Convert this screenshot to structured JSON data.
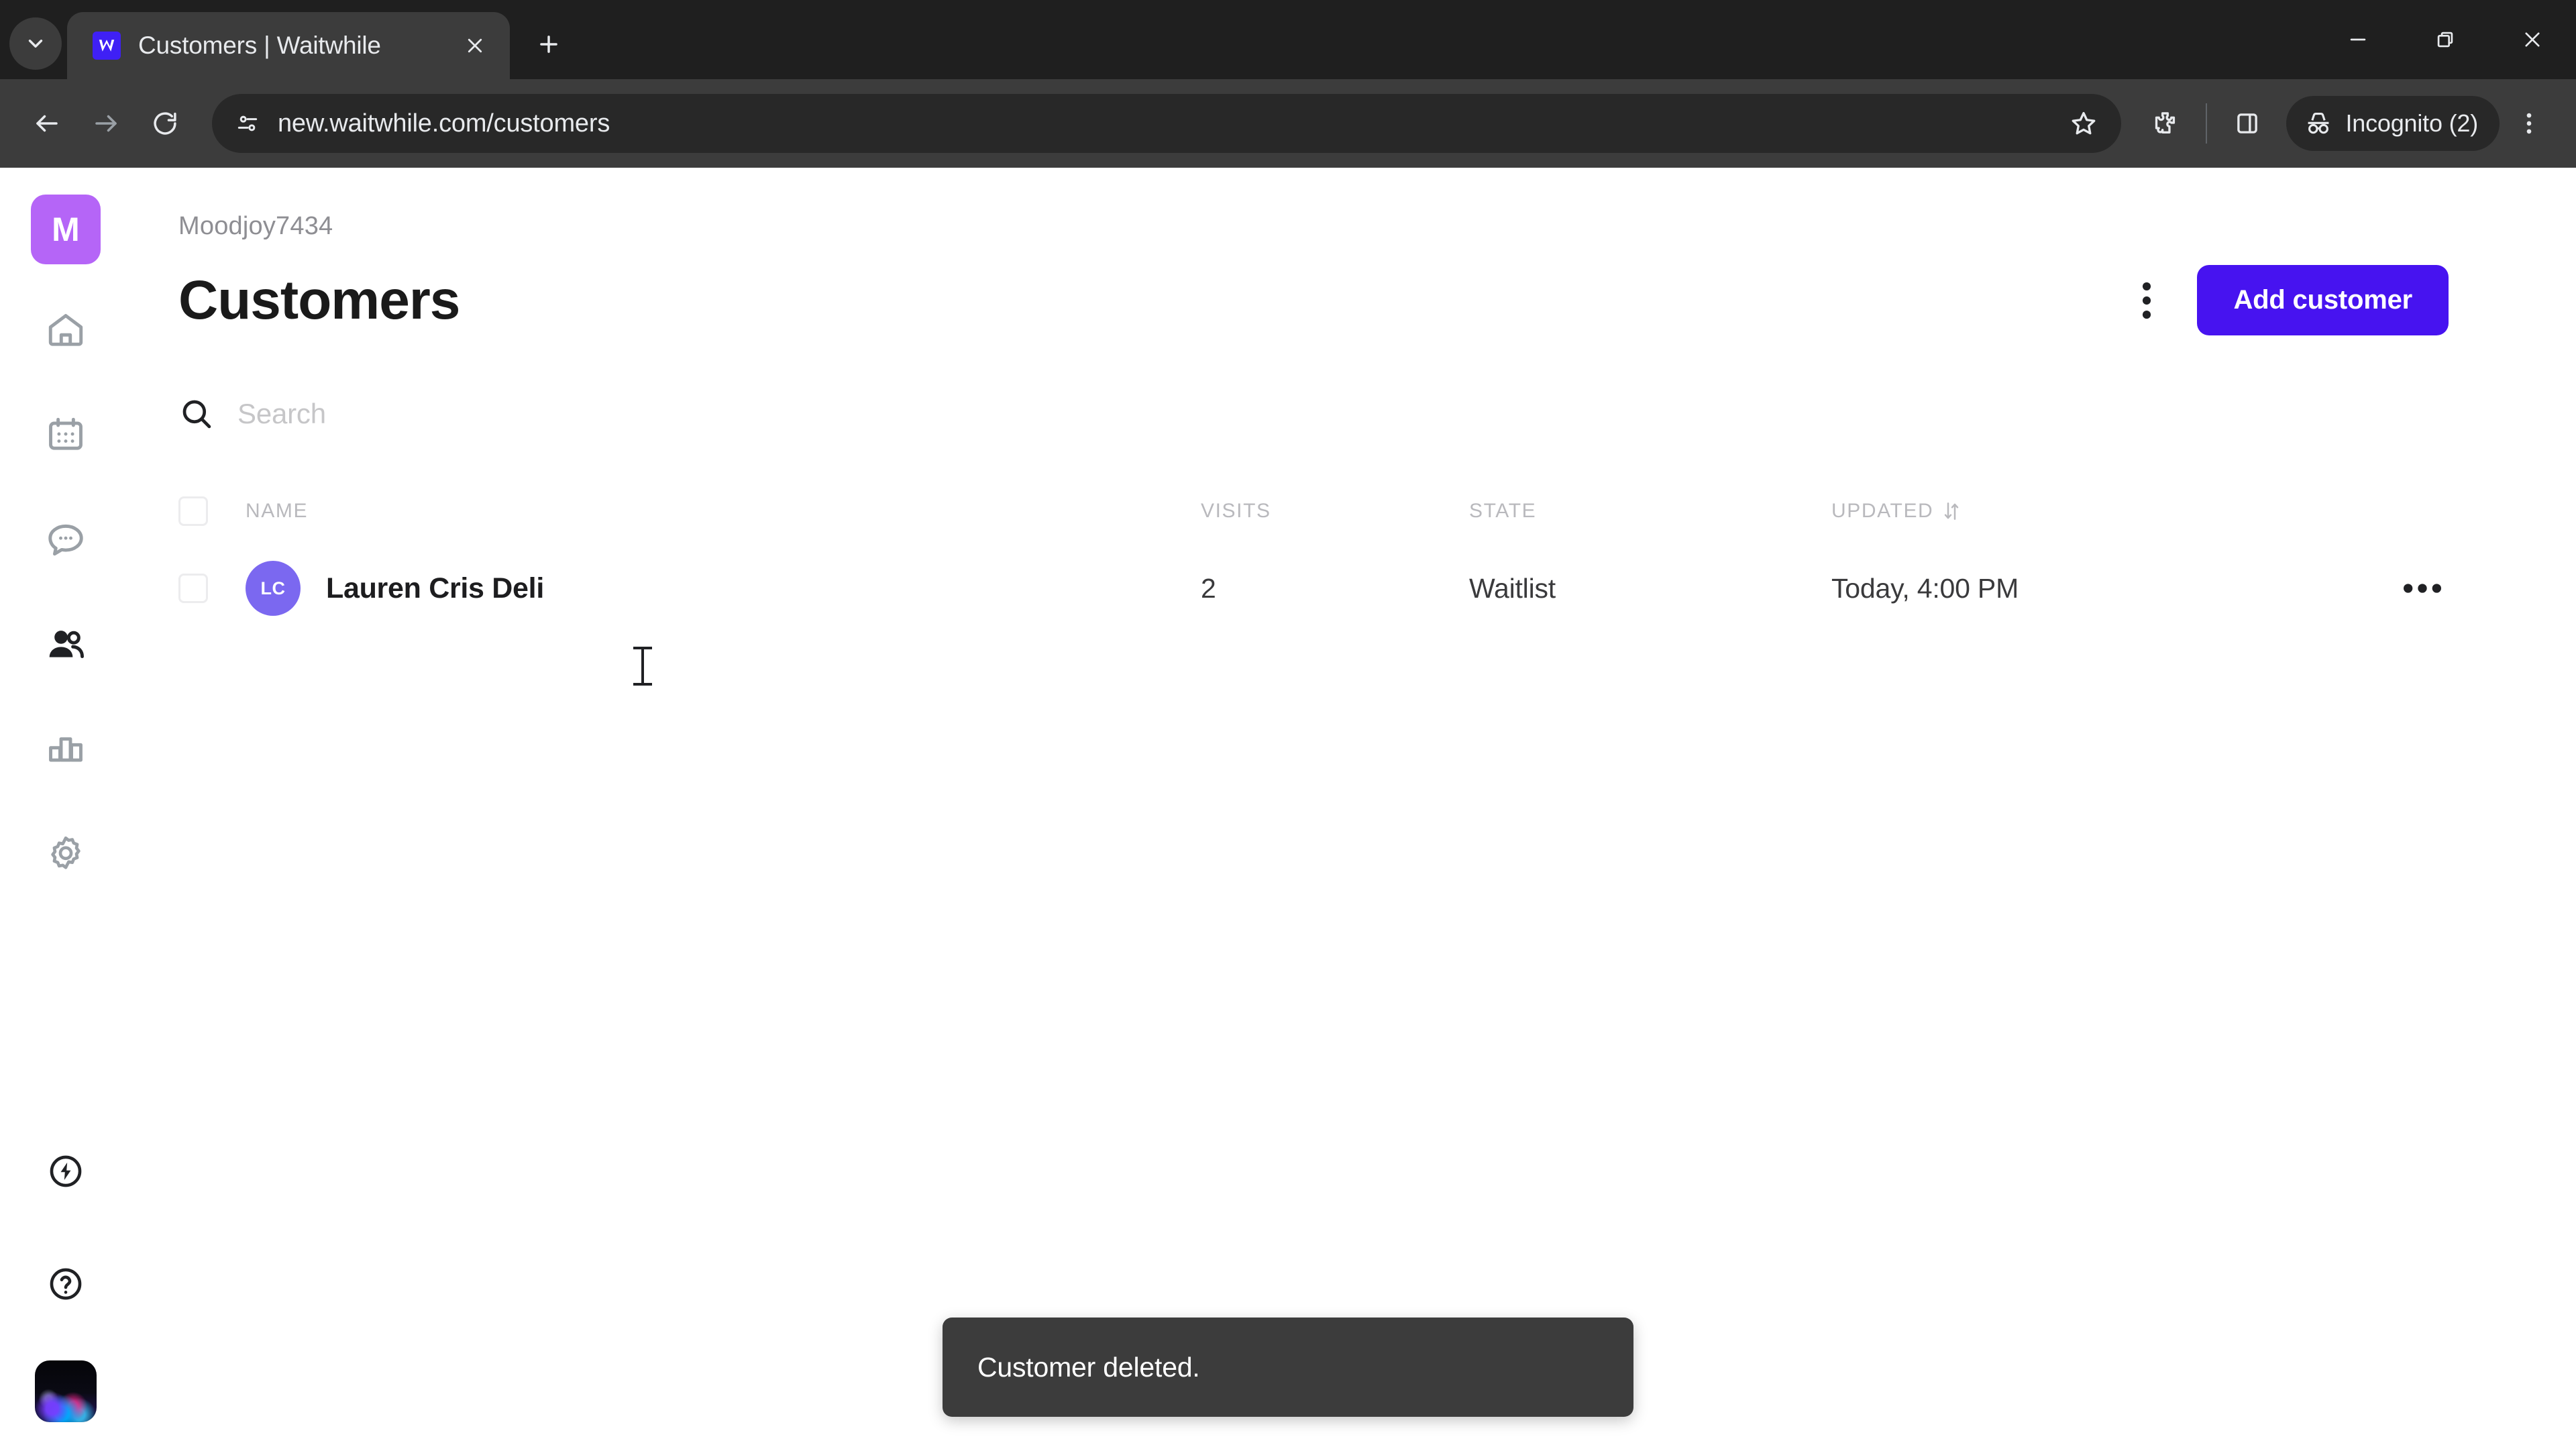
{
  "browser": {
    "tab_search_icon": "chevron-down-icon",
    "tab": {
      "favicon": "waitwhile-favicon",
      "title": "Customers | Waitwhile",
      "close_icon": "close-icon"
    },
    "new_tab_icon": "plus-icon",
    "window_controls": {
      "minimize": "minimize-icon",
      "maximize": "restore-icon",
      "close": "close-icon"
    },
    "toolbar": {
      "back_icon": "back-arrow-icon",
      "forward_icon": "forward-arrow-icon",
      "reload_icon": "reload-icon",
      "site_info_icon": "tune-icon",
      "url": "new.waitwhile.com/customers",
      "bookmark_icon": "star-icon",
      "extensions_icon": "puzzle-icon",
      "side_panel_icon": "side-panel-icon",
      "profile_icon": "incognito-icon",
      "profile_label": "Incognito (2)",
      "menu_icon": "kebab-menu-icon"
    }
  },
  "sidebar": {
    "brand_initial": "M",
    "brand_color": "#b565f7",
    "items": [
      {
        "name": "home",
        "icon": "home-icon",
        "active": false
      },
      {
        "name": "schedule",
        "icon": "calendar-icon",
        "active": false
      },
      {
        "name": "messages",
        "icon": "chat-bubble-icon",
        "active": false
      },
      {
        "name": "customers",
        "icon": "people-icon",
        "active": true
      },
      {
        "name": "analytics",
        "icon": "bar-chart-icon",
        "active": false
      },
      {
        "name": "settings",
        "icon": "gear-icon",
        "active": false
      }
    ],
    "bottom_items": [
      {
        "name": "whats-new",
        "icon": "lightning-bolt-circle-icon"
      },
      {
        "name": "help",
        "icon": "question-circle-icon"
      }
    ],
    "avatar": "user-avatar-photo"
  },
  "page": {
    "org_name": "Moodjoy7434",
    "title": "Customers",
    "kebab_icon": "kebab-menu-icon",
    "add_button_label": "Add customer",
    "accent_color": "#4713f0"
  },
  "search": {
    "icon": "search-icon",
    "value": "",
    "placeholder": "Search"
  },
  "table": {
    "columns": [
      {
        "key": "name",
        "label": "NAME",
        "sorted": false
      },
      {
        "key": "visits",
        "label": "VISITS",
        "sorted": false
      },
      {
        "key": "state",
        "label": "STATE",
        "sorted": false
      },
      {
        "key": "updated",
        "label": "UPDATED",
        "sorted": true,
        "sort_icon": "sort-icon"
      }
    ],
    "select_all_checked": false,
    "rows": [
      {
        "checked": false,
        "initials": "LC",
        "avatar_color": "#7b68f0",
        "name": "Lauren Cris Deli",
        "visits": "2",
        "state": "Waitlist",
        "updated": "Today, 4:00 PM",
        "actions_icon": "more-horizontal-icon"
      }
    ]
  },
  "toast": {
    "message": "Customer deleted."
  }
}
